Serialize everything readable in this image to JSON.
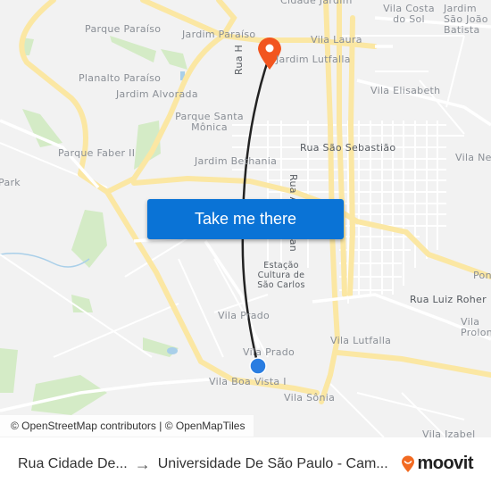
{
  "map": {
    "labels": [
      {
        "text": "Cidade Jardim",
        "kind": "area"
      },
      {
        "text": "Parque Paraíso",
        "kind": "area"
      },
      {
        "text": "Jardim Paraíso",
        "kind": "area"
      },
      {
        "text": "Vila Costa do Sol",
        "kind": "area"
      },
      {
        "text": "Jardim São João Batista",
        "kind": "area"
      },
      {
        "text": "Vila Laura",
        "kind": "area"
      },
      {
        "text": "Jardim Lutfalla",
        "kind": "area"
      },
      {
        "text": "Planalto Paraíso",
        "kind": "area"
      },
      {
        "text": "Jardim Alvorada",
        "kind": "area"
      },
      {
        "text": "Vila Elisabeth",
        "kind": "area"
      },
      {
        "text": "Parque Santa Mônica",
        "kind": "area"
      },
      {
        "text": "Rua São Sebastião",
        "kind": "street"
      },
      {
        "text": "Parque Faber II",
        "kind": "area"
      },
      {
        "text": "Jardim Bethania",
        "kind": "area"
      },
      {
        "text": "Vila Nery",
        "kind": "area"
      },
      {
        "text": "Park",
        "kind": "area"
      },
      {
        "text": "Rua H",
        "kind": "street"
      },
      {
        "text": "Rua Aquidaban",
        "kind": "street"
      },
      {
        "text": "Estação Cultura de São Carlos",
        "kind": "poi"
      },
      {
        "text": "Ponte",
        "kind": "area"
      },
      {
        "text": "Rua Luiz Roher",
        "kind": "street"
      },
      {
        "text": "Vila Prado",
        "kind": "area"
      },
      {
        "text": "Vila Lutfalla",
        "kind": "area"
      },
      {
        "text": "Vila Prolongamento",
        "kind": "area"
      },
      {
        "text": "Vila Prado",
        "kind": "area"
      },
      {
        "text": "Vila Boa Vista I",
        "kind": "area"
      },
      {
        "text": "Vila Sônia",
        "kind": "area"
      },
      {
        "text": "Vila Izabel",
        "kind": "area"
      }
    ],
    "origin_marker": {
      "type": "current-stop",
      "color": "#2a7de1"
    },
    "destination_marker": {
      "type": "destination-pin",
      "color": "#f2551f"
    },
    "route_color": "#222222"
  },
  "cta": {
    "label": "Take me there",
    "color": "#0a73d6"
  },
  "attribution": "© OpenStreetMap contributors | © OpenMapTiles",
  "footer": {
    "from": "Rua Cidade De...",
    "arrow": "→",
    "to": "Universidade De São Paulo - Cam...",
    "brand": "moovit",
    "brand_color": "#f26a21"
  }
}
